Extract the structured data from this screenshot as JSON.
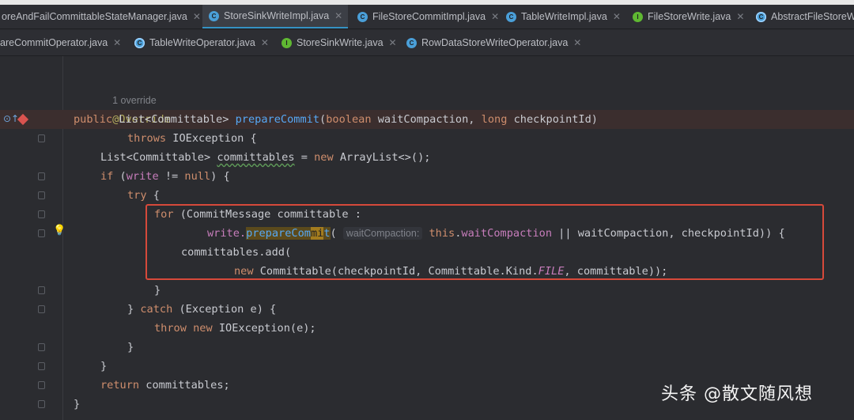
{
  "tabs_row1": [
    {
      "label": "oreAndFailCommittableStateManager.java",
      "icon": "none",
      "active": false
    },
    {
      "label": "StoreSinkWriteImpl.java",
      "icon": "class",
      "active": true
    },
    {
      "label": "FileStoreCommitImpl.java",
      "icon": "class",
      "active": false
    },
    {
      "label": "TableWriteImpl.java",
      "icon": "class",
      "active": false
    },
    {
      "label": "FileStoreWrite.java",
      "icon": "interface",
      "active": false
    },
    {
      "label": "AbstractFileStoreW",
      "icon": "class-abstract",
      "active": false
    }
  ],
  "tabs_row2": [
    {
      "label": "areCommitOperator.java",
      "icon": "none"
    },
    {
      "label": "TableWriteOperator.java",
      "icon": "class-abstract"
    },
    {
      "label": "StoreSinkWrite.java",
      "icon": "interface"
    },
    {
      "label": "RowDataStoreWriteOperator.java",
      "icon": "class"
    }
  ],
  "code": {
    "usage_hint": "1 override",
    "override_annotation": "@Override",
    "line_signature": {
      "public": "public",
      "type": "List<Committable>",
      "method": "prepareCommit",
      "open": "(",
      "boolean": "boolean",
      "param1": " waitCompaction, ",
      "long": "long",
      "param2": " checkpointId)"
    },
    "line_throws": {
      "throws": "throws",
      "rest": " IOException {"
    },
    "line_list": {
      "type": "List<Committable> ",
      "var": "committables",
      "eq": " = ",
      "new": "new",
      "rest": " ArrayList<>();"
    },
    "line_if": {
      "if": "if",
      "open": " (",
      "write": "write",
      "neq": " != ",
      "null": "null",
      "close": ") {"
    },
    "line_try": {
      "try": "try",
      "rest": " {"
    },
    "line_for": {
      "for": "for",
      "rest": " (CommitMessage committable :"
    },
    "line_write": {
      "write": "write.",
      "sel_a": "prepareCom",
      "sel_b": "mi",
      "sel_c": "t",
      "open": "(",
      "hint": "waitCompaction:",
      "this": "this",
      "dot": ".",
      "field": "waitCompaction",
      "rest": " || waitCompaction, checkpointId)) {"
    },
    "line_add": "committables.add(",
    "line_new": {
      "new": "new",
      "rest1": " Committable(checkpointId, Committable.Kind.",
      "file": "FILE",
      "rest2": ", committable));"
    },
    "line_close_for": "}",
    "line_catch": {
      "close": "} ",
      "catch": "catch",
      "rest": " (Exception e) {"
    },
    "line_throw": {
      "throw": "throw",
      "sp": " ",
      "new": "new",
      "rest": " IOException(e);"
    },
    "line_close_catch": "}",
    "line_close_if": "}",
    "line_return": {
      "return": "return",
      "rest": " committables;"
    },
    "line_close_method": "}"
  },
  "watermark": "头条 @散文随风想",
  "colors": {
    "keyword": "#cf8e6d",
    "method": "#56a8f5",
    "field": "#c77dbb",
    "annotation": "#b3ae60",
    "highlight_box": "#d6493a"
  }
}
